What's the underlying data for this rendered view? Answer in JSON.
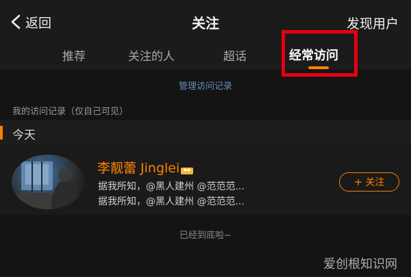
{
  "header": {
    "back_label": "返回",
    "title": "关注",
    "right_action": "发现用户"
  },
  "tabs": [
    {
      "label": "推荐",
      "active": false
    },
    {
      "label": "关注的人",
      "active": false
    },
    {
      "label": "超话",
      "active": false
    },
    {
      "label": "经常访问",
      "active": true
    }
  ],
  "manage_link": "管理访问记录",
  "section_label": "我的访问记录（仅自己可见）",
  "group_label": "今天",
  "visit_item": {
    "username": "李靓蕾 Jinglei",
    "badge_icon": "vip-crown-icon",
    "desc_line1": "据我所知，@黑人建州 @范范范...",
    "desc_line2": "据我所知，@黑人建州 @范范范...",
    "follow_label": "关注",
    "follow_icon": "plus-icon"
  },
  "footer_text": "已经到底啦~",
  "watermark": "爱创根知识网",
  "colors": {
    "accent": "#ff8200",
    "highlight_box": "#e60012",
    "link": "#6a8fc0",
    "background": "#141414"
  }
}
